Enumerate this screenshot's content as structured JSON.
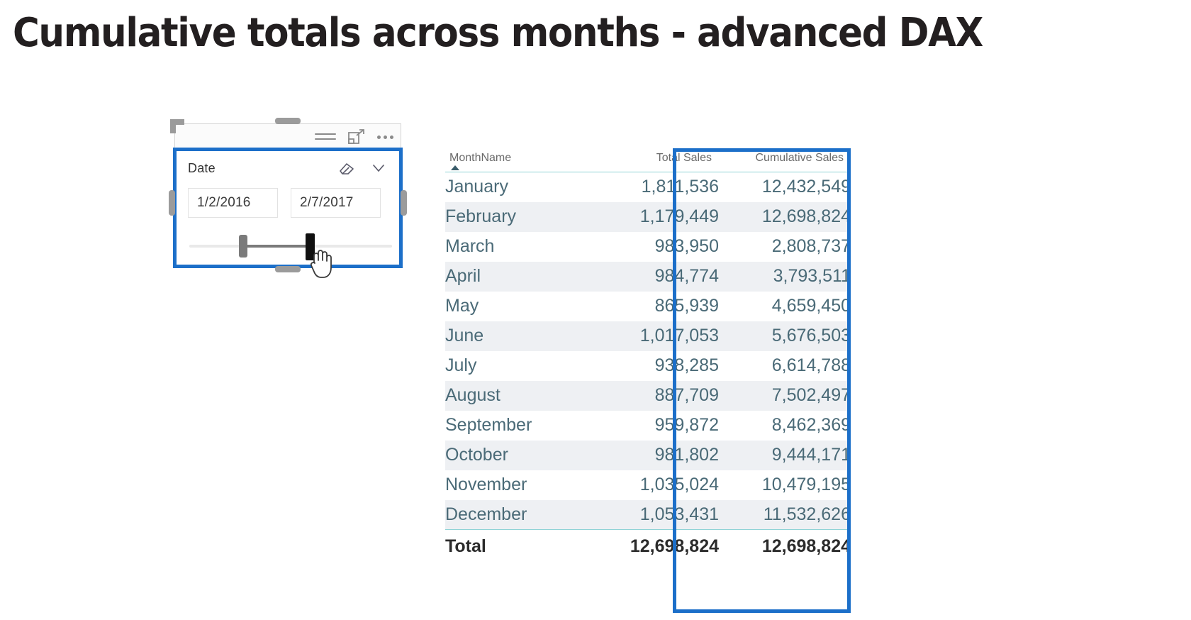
{
  "page": {
    "title": "Cumulative totals across months - advanced DAX",
    "accent_blue": "#1c6fc9",
    "header_underline": "#8fd3d6",
    "row_alt_bg": "#eef0f3",
    "text_color": "#4a6a77"
  },
  "slicer": {
    "field_label": "Date",
    "start_date": "1/2/2016",
    "end_date": "2/7/2017",
    "icons": {
      "filter": "filter-icon",
      "focus": "focus-mode-icon",
      "more": "more-options-icon",
      "clear": "eraser-clear-filter-icon",
      "expand": "chevron-down-icon"
    },
    "slider": {
      "left_handle_pct": 24,
      "right_handle_pct": 57,
      "cursor": "hand-pointer-cursor"
    }
  },
  "table": {
    "columns": [
      "MonthName",
      "Total Sales",
      "Cumulative Sales"
    ],
    "sort_column": "MonthName",
    "sort_direction": "ascending",
    "highlighted_column": "Cumulative Sales",
    "rows": [
      {
        "month": "January",
        "total_sales": "1,811,536",
        "cumulative_sales": "12,432,549"
      },
      {
        "month": "February",
        "total_sales": "1,179,449",
        "cumulative_sales": "12,698,824"
      },
      {
        "month": "March",
        "total_sales": "983,950",
        "cumulative_sales": "2,808,737"
      },
      {
        "month": "April",
        "total_sales": "984,774",
        "cumulative_sales": "3,793,511"
      },
      {
        "month": "May",
        "total_sales": "865,939",
        "cumulative_sales": "4,659,450"
      },
      {
        "month": "June",
        "total_sales": "1,017,053",
        "cumulative_sales": "5,676,503"
      },
      {
        "month": "July",
        "total_sales": "938,285",
        "cumulative_sales": "6,614,788"
      },
      {
        "month": "August",
        "total_sales": "887,709",
        "cumulative_sales": "7,502,497"
      },
      {
        "month": "September",
        "total_sales": "959,872",
        "cumulative_sales": "8,462,369"
      },
      {
        "month": "October",
        "total_sales": "981,802",
        "cumulative_sales": "9,444,171"
      },
      {
        "month": "November",
        "total_sales": "1,035,024",
        "cumulative_sales": "10,479,195"
      },
      {
        "month": "December",
        "total_sales": "1,053,431",
        "cumulative_sales": "11,532,626"
      }
    ],
    "total_row": {
      "label": "Total",
      "total_sales": "12,698,824",
      "cumulative_sales": "12,698,824"
    }
  },
  "chart_data": {
    "type": "table",
    "title": "Cumulative totals across months - advanced DAX",
    "categories": [
      "January",
      "February",
      "March",
      "April",
      "May",
      "June",
      "July",
      "August",
      "September",
      "October",
      "November",
      "December"
    ],
    "series": [
      {
        "name": "Total Sales",
        "values": [
          1811536,
          1179449,
          983950,
          984774,
          865939,
          1017053,
          938285,
          887709,
          959872,
          981802,
          1035024,
          1053431
        ]
      },
      {
        "name": "Cumulative Sales",
        "values": [
          12432549,
          12698824,
          2808737,
          3793511,
          4659450,
          5676503,
          6614788,
          7502497,
          8462369,
          9444171,
          10479195,
          11532626
        ]
      }
    ],
    "totals": {
      "Total Sales": 12698824,
      "Cumulative Sales": 12698824
    },
    "xlabel": "MonthName",
    "ylabel": "",
    "legend": "none",
    "grid": false
  }
}
